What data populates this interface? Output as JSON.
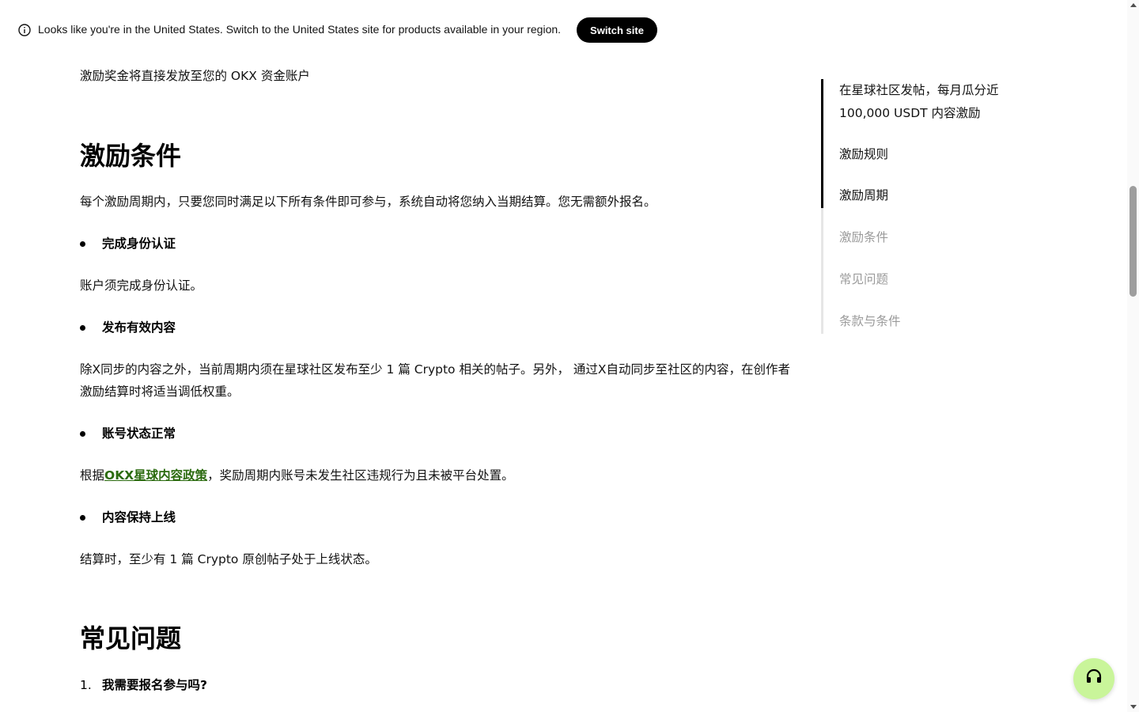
{
  "banner": {
    "message": "Looks like you're in the United States. Switch to the United States site for products available in your region.",
    "switch_button": "Switch site"
  },
  "article": {
    "intro_line": "激励奖金将直接发放至您的 OKX 资金账户",
    "conditions_heading": "激励条件",
    "conditions_intro": "每个激励周期内，只要您同时满足以下所有条件即可参与，系统自动将您纳入当期结算。您无需额外报名。",
    "conditions": [
      {
        "title": "完成身份认证",
        "desc": "账户须完成身份认证。"
      },
      {
        "title": "发布有效内容",
        "desc": "除X同步的内容之外，当前周期内须在星球社区发布至少 1 篇 Crypto 相关的帖子。另外， 通过X自动同步至社区的内容，在创作者激励结算时将适当调低权重。"
      },
      {
        "title": "账号状态正常",
        "desc_prefix": "根据",
        "desc_link": "OKX星球内容政策",
        "desc_suffix": "，奖励周期内账号未发生社区违规行为且未被平台处置。"
      },
      {
        "title": "内容保持上线",
        "desc": "结算时，至少有 1 篇 Crypto 原创帖子处于上线状态。"
      }
    ],
    "faq_heading": "常见问题",
    "faq": [
      {
        "number": "1.",
        "question": "我需要报名参与吗?"
      }
    ]
  },
  "toc": {
    "items": [
      {
        "label": "在星球社区发帖，每月瓜分近 100,000 USDT 内容激励",
        "state": "read"
      },
      {
        "label": "激励规则",
        "state": "read"
      },
      {
        "label": "激励周期",
        "state": "read"
      },
      {
        "label": "激励条件",
        "state": "unread"
      },
      {
        "label": "常见问题",
        "state": "unread"
      },
      {
        "label": "条款与条件",
        "state": "unread"
      }
    ]
  },
  "colors": {
    "link": "#2b6b0f",
    "support_button": "#c9f59a",
    "toc_muted": "#9a9a9a"
  },
  "icons": {
    "banner": "info-icon",
    "support": "headset-icon"
  }
}
